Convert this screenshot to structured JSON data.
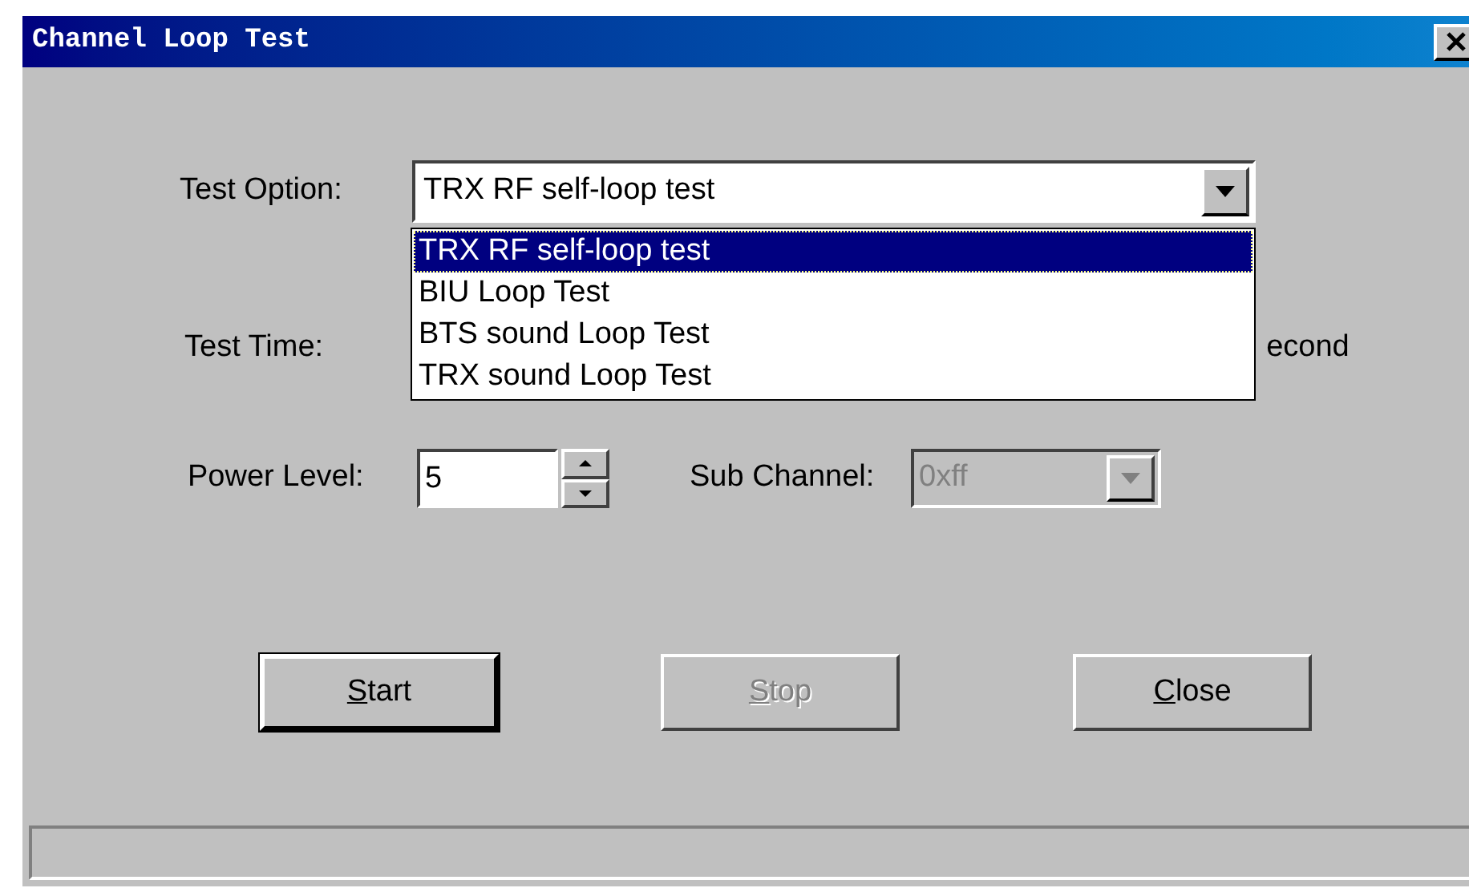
{
  "window": {
    "title": "Channel Loop Test"
  },
  "test_option": {
    "label": "Test Option:",
    "value": "TRX RF self-loop test",
    "expanded": true,
    "options": [
      {
        "label": "TRX RF self-loop test",
        "selected": true
      },
      {
        "label": "BIU Loop Test",
        "selected": false
      },
      {
        "label": "BTS sound Loop Test",
        "selected": false
      },
      {
        "label": "TRX sound Loop Test",
        "selected": false
      }
    ]
  },
  "test_time": {
    "label": "Test Time:",
    "unit": "econd"
  },
  "power_level": {
    "label": "Power Level:",
    "value": "5"
  },
  "sub_channel": {
    "label": "Sub Channel:",
    "value": "0xff",
    "disabled": true
  },
  "buttons": [
    {
      "label": "Start",
      "disabled": false,
      "default": true
    },
    {
      "label": "Stop",
      "disabled": true,
      "default": false
    },
    {
      "label": "Close",
      "disabled": false,
      "default": false
    }
  ]
}
